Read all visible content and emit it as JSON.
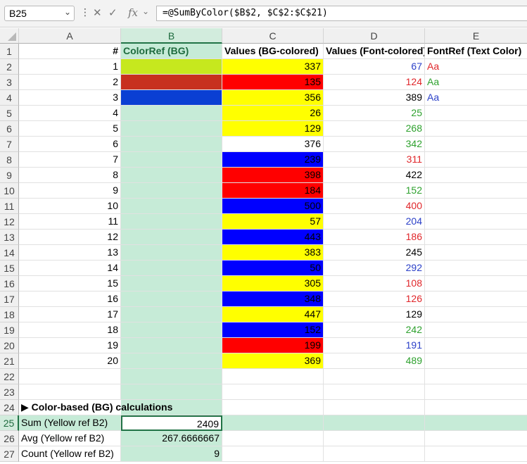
{
  "formula_bar": {
    "name_box": "B25",
    "fx_label": "fx",
    "formula": "=@SumByColor($B$2, $C$2:$C$21)"
  },
  "columns": [
    "A",
    "B",
    "C",
    "D",
    "E"
  ],
  "row_numbers": [
    "1",
    "2",
    "3",
    "4",
    "5",
    "6",
    "7",
    "8",
    "9",
    "10",
    "11",
    "12",
    "13",
    "14",
    "15",
    "16",
    "17",
    "18",
    "19",
    "20",
    "21",
    "22",
    "23",
    "24",
    "25",
    "26",
    "27"
  ],
  "header_row": {
    "a": "#",
    "b": "ColorRef (BG)",
    "c": "Values (BG-colored)",
    "d": "Values (Font-colored)",
    "e": "FontRef (Text Color)"
  },
  "colors": {
    "yellow": "#ffff00",
    "red": "#ff0000",
    "blue": "#0000ff",
    "white": "#ffffff",
    "selection_fill": "#c6ebd7",
    "lime": "#c6e81e",
    "brick": "#c7301e",
    "royal": "#0a3fd3",
    "font_blue": "#2b40c8",
    "font_red": "#e0262a",
    "font_green": "#2ea12e",
    "font_black": "#000000",
    "accent": "#217346"
  },
  "data_rows": [
    {
      "num": "1",
      "b_color": "lime",
      "c": "337",
      "c_bg": "yellow",
      "d": "67",
      "d_color": "font_blue",
      "e": "Aa",
      "e_color": "font_red"
    },
    {
      "num": "2",
      "b_color": "brick",
      "c": "135",
      "c_bg": "red",
      "d": "124",
      "d_color": "font_red",
      "e": "Aa",
      "e_color": "font_green"
    },
    {
      "num": "3",
      "b_color": "royal",
      "c": "356",
      "c_bg": "yellow",
      "d": "389",
      "d_color": "font_black",
      "e": "Aa",
      "e_color": "font_blue"
    },
    {
      "num": "4",
      "c": "26",
      "c_bg": "yellow",
      "d": "25",
      "d_color": "font_green"
    },
    {
      "num": "5",
      "c": "129",
      "c_bg": "yellow",
      "d": "268",
      "d_color": "font_green"
    },
    {
      "num": "6",
      "c": "376",
      "c_bg": "white",
      "d": "342",
      "d_color": "font_green"
    },
    {
      "num": "7",
      "c": "239",
      "c_bg": "blue",
      "d": "311",
      "d_color": "font_red"
    },
    {
      "num": "8",
      "c": "398",
      "c_bg": "red",
      "d": "422",
      "d_color": "font_black"
    },
    {
      "num": "9",
      "c": "184",
      "c_bg": "red",
      "d": "152",
      "d_color": "font_green"
    },
    {
      "num": "10",
      "c": "500",
      "c_bg": "blue",
      "d": "400",
      "d_color": "font_red"
    },
    {
      "num": "11",
      "c": "57",
      "c_bg": "yellow",
      "d": "204",
      "d_color": "font_blue"
    },
    {
      "num": "12",
      "c": "443",
      "c_bg": "blue",
      "d": "186",
      "d_color": "font_red"
    },
    {
      "num": "13",
      "c": "383",
      "c_bg": "yellow",
      "d": "245",
      "d_color": "font_black"
    },
    {
      "num": "14",
      "c": "50",
      "c_bg": "blue",
      "d": "292",
      "d_color": "font_blue"
    },
    {
      "num": "15",
      "c": "305",
      "c_bg": "yellow",
      "d": "108",
      "d_color": "font_red"
    },
    {
      "num": "16",
      "c": "348",
      "c_bg": "blue",
      "d": "126",
      "d_color": "font_red"
    },
    {
      "num": "17",
      "c": "447",
      "c_bg": "yellow",
      "d": "129",
      "d_color": "font_black"
    },
    {
      "num": "18",
      "c": "152",
      "c_bg": "blue",
      "d": "242",
      "d_color": "font_green"
    },
    {
      "num": "19",
      "c": "199",
      "c_bg": "red",
      "d": "191",
      "d_color": "font_blue"
    },
    {
      "num": "20",
      "c": "369",
      "c_bg": "yellow",
      "d": "489",
      "d_color": "font_green"
    }
  ],
  "section_title": "▶ Color-based (BG) calculations",
  "calc_rows": [
    {
      "label": "Sum (Yellow ref B2)",
      "value": "2409"
    },
    {
      "label": "Avg (Yellow ref B2)",
      "value": "267.6666667"
    },
    {
      "label": "Count (Yellow ref B2)",
      "value": "9"
    }
  ]
}
